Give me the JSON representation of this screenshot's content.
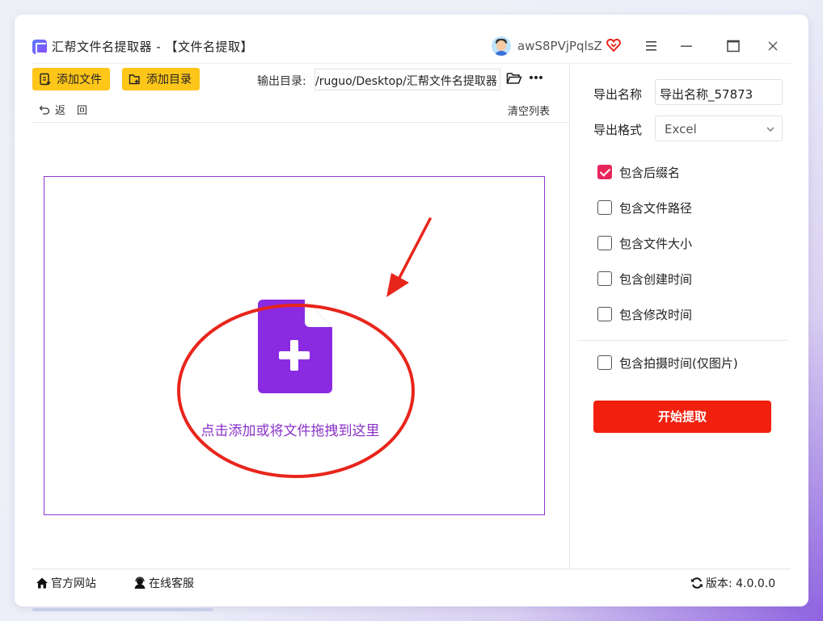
{
  "window": {
    "title": "汇帮文件名提取器 - 【文件名提取】",
    "username": "awS8PVjPqlsZ",
    "icons": [
      "app-logo",
      "avatar",
      "vip-heart-icon",
      "menu-icon",
      "minimize-icon",
      "maximize-icon",
      "close-icon"
    ]
  },
  "toolbar": {
    "add_file_label": "添加文件",
    "add_dir_label": "添加目录",
    "output_label": "输出目录:",
    "output_path": "/ruguo/Desktop/汇帮文件名提取器",
    "back_label": "返回",
    "clear_label": "清空列表"
  },
  "dropzone": {
    "prompt": "点击添加或将文件拖拽到这里",
    "accent_color": "#8e3bd0",
    "annotation_color": "#e8251b"
  },
  "settings": {
    "export_name_label": "导出名称",
    "export_name_value": "导出名称_57873",
    "export_format_label": "导出格式",
    "export_format_value": "Excel",
    "options": [
      {
        "label": "包含后缀名",
        "checked": true
      },
      {
        "label": "包含文件路径",
        "checked": false
      },
      {
        "label": "包含文件大小",
        "checked": false
      },
      {
        "label": "包含创建时间",
        "checked": false
      },
      {
        "label": "包含修改时间",
        "checked": false
      }
    ],
    "photo_option": {
      "label": "包含拍摄时间(仅图片)",
      "checked": false
    },
    "start_label": "开始提取",
    "start_color": "#f2200f",
    "check_color": "#e8255a"
  },
  "statusbar": {
    "website_label": "官方网站",
    "support_label": "在线客服",
    "version_label": "版本: 4.0.0.0"
  }
}
